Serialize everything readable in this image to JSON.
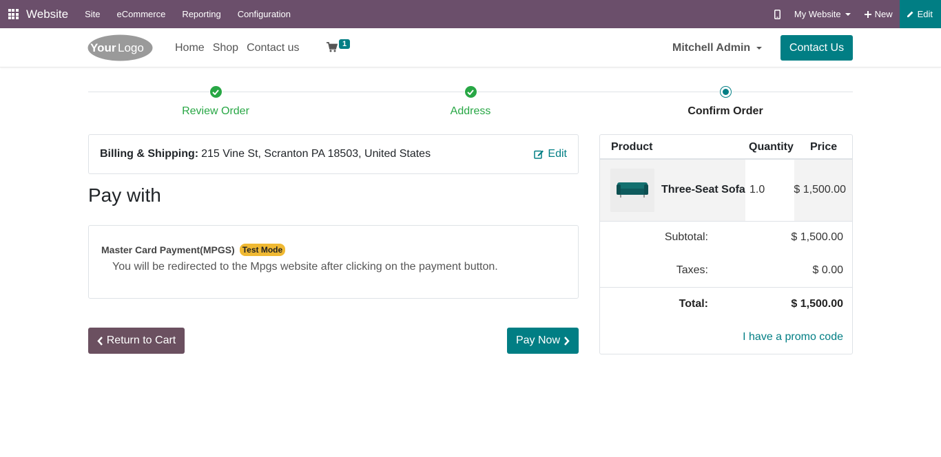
{
  "adminbar": {
    "brand": "Website",
    "menu": [
      "Site",
      "eCommerce",
      "Reporting",
      "Configuration"
    ],
    "website_selector": "My Website",
    "new_label": "New",
    "edit_label": "Edit"
  },
  "header": {
    "nav": [
      "Home",
      "Shop",
      "Contact us"
    ],
    "cart_count": "1",
    "user": "Mitchell Admin",
    "contact_button": "Contact Us"
  },
  "steps": [
    {
      "label": "Review Order",
      "state": "done"
    },
    {
      "label": "Address",
      "state": "done"
    },
    {
      "label": "Confirm Order",
      "state": "current"
    }
  ],
  "billing": {
    "label": "Billing & Shipping:",
    "address": "215 Vine St, Scranton PA 18503, United States",
    "edit_label": "Edit"
  },
  "payment": {
    "heading": "Pay with",
    "method": "Master Card Payment(MPGS)",
    "badge": "Test Mode",
    "description": "You will be redirected to the Mpgs website after clicking on the payment button."
  },
  "buttons": {
    "return": "Return to Cart",
    "pay": "Pay Now"
  },
  "summary": {
    "headers": {
      "product": "Product",
      "quantity": "Quantity",
      "price": "Price"
    },
    "item": {
      "name": "Three-Seat Sofa",
      "quantity": "1.0",
      "price": "$ 1,500.00"
    },
    "subtotal_label": "Subtotal:",
    "subtotal": "$ 1,500.00",
    "taxes_label": "Taxes:",
    "taxes": "$ 0.00",
    "total_label": "Total:",
    "total": "$ 1,500.00",
    "promo": "I have a promo code"
  },
  "colors": {
    "admin_bar": "#6b4f6b",
    "accent": "#017e84",
    "success": "#28a745",
    "badge": "#f0b933"
  }
}
